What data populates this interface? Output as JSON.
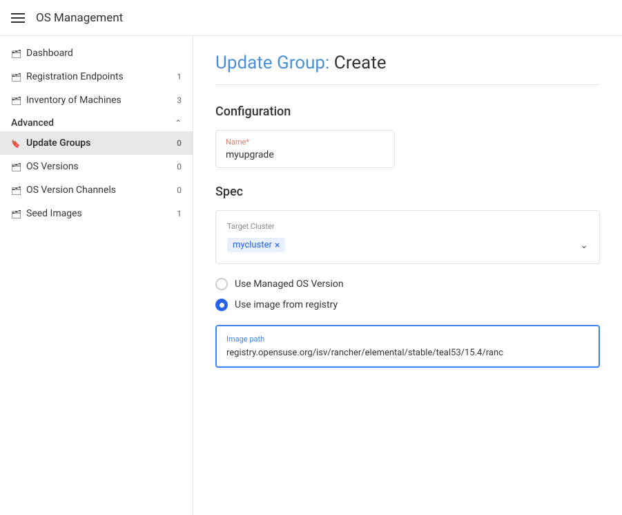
{
  "header": {
    "title": "OS Management"
  },
  "sidebar": {
    "items": [
      {
        "id": "dashboard",
        "label": "Dashboard",
        "icon": "folder",
        "badge": null
      },
      {
        "id": "registration-endpoints",
        "label": "Registration Endpoints",
        "icon": "folder",
        "badge": "1"
      },
      {
        "id": "inventory-of-machines",
        "label": "Inventory of Machines",
        "icon": "folder",
        "badge": "3"
      }
    ],
    "advanced_section": {
      "label": "Advanced",
      "expanded": true,
      "items": [
        {
          "id": "update-groups",
          "label": "Update Groups",
          "icon": "bookmark",
          "badge": "0",
          "active": true
        },
        {
          "id": "os-versions",
          "label": "OS Versions",
          "icon": "folder",
          "badge": "0"
        },
        {
          "id": "os-version-channels",
          "label": "OS Version Channels",
          "icon": "folder",
          "badge": "0"
        },
        {
          "id": "seed-images",
          "label": "Seed Images",
          "icon": "folder",
          "badge": "1"
        }
      ]
    }
  },
  "main": {
    "page_title_prefix": "Update Group: ",
    "page_title_action": "Create",
    "sections": {
      "configuration": {
        "title": "Configuration",
        "name_field": {
          "label": "Name*",
          "value": "myupgrade"
        }
      },
      "spec": {
        "title": "Spec",
        "target_cluster": {
          "label": "Target Cluster",
          "tag": "mycluster"
        },
        "radio_options": [
          {
            "id": "managed-os",
            "label": "Use Managed OS Version",
            "selected": false
          },
          {
            "id": "image-registry",
            "label": "Use image from registry",
            "selected": true
          }
        ],
        "image_path": {
          "label": "Image path",
          "value": "registry.opensuse.org/isv/rancher/elemental/stable/teal53/15.4/ranc"
        }
      }
    }
  }
}
